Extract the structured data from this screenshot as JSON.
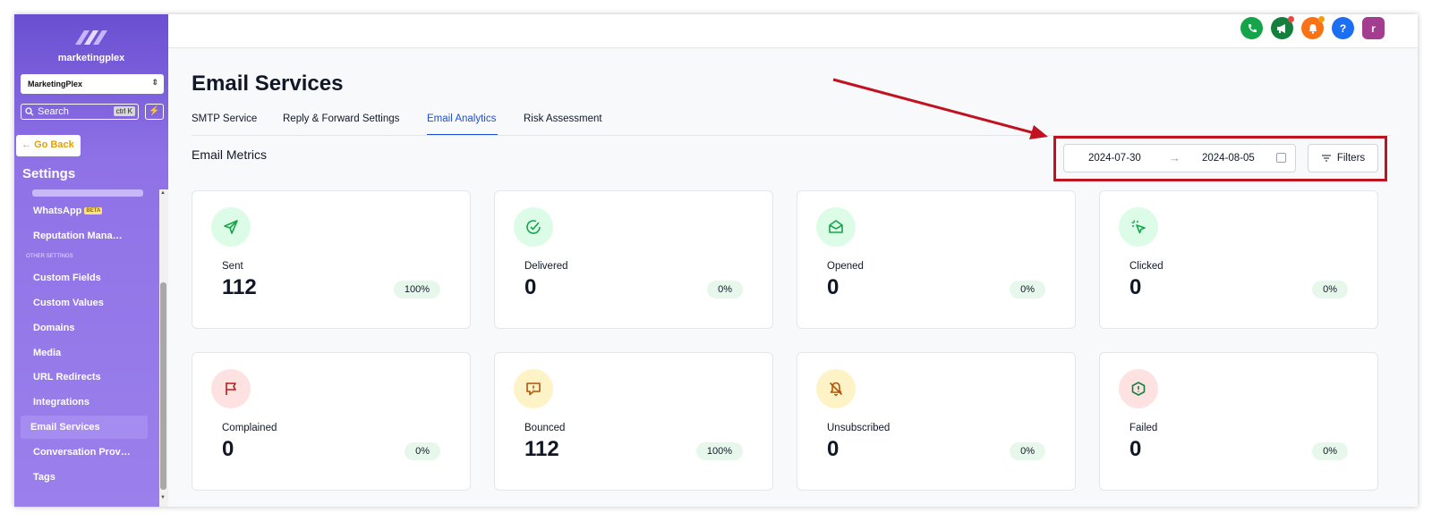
{
  "sidebar": {
    "brand": "marketingplex",
    "account": "MarketingPlex",
    "search_label": "Search",
    "search_shortcut": "ctrl K",
    "go_back": "Go Back",
    "settings_title": "Settings",
    "items": [
      {
        "label": "WhatsApp",
        "badge": "BETA"
      },
      {
        "label": "Reputation Mana…"
      }
    ],
    "section_label": "OTHER SETTINGS",
    "other_items": [
      {
        "label": "Custom Fields"
      },
      {
        "label": "Custom Values"
      },
      {
        "label": "Domains"
      },
      {
        "label": "Media"
      },
      {
        "label": "URL Redirects"
      },
      {
        "label": "Integrations"
      },
      {
        "label": "Email Services"
      },
      {
        "label": "Conversation Prov…"
      },
      {
        "label": "Tags"
      }
    ],
    "active_item": "Email Services"
  },
  "topbar": {
    "avatar_letter": "r",
    "icons": [
      "phone-icon",
      "megaphone-icon",
      "bell-icon",
      "help-icon",
      "avatar"
    ],
    "colors": {
      "phone": "#16a34a",
      "megaphone": "#15803d",
      "bell": "#f97316",
      "help": "#1d6ff2",
      "avatar": "#a23d8f"
    }
  },
  "page": {
    "title": "Email Services",
    "tabs": [
      {
        "label": "SMTP Service"
      },
      {
        "label": "Reply & Forward Settings"
      },
      {
        "label": "Email Analytics",
        "active": true
      },
      {
        "label": "Risk Assessment"
      }
    ],
    "section_title": "Email Metrics",
    "date_range": {
      "start": "2024-07-30",
      "arrow": "→",
      "end": "2024-08-05"
    },
    "filters_label": "Filters"
  },
  "metrics": [
    {
      "label": "Sent",
      "value": "112",
      "percent": "100%",
      "icon": "send-icon",
      "color": "green"
    },
    {
      "label": "Delivered",
      "value": "0",
      "percent": "0%",
      "icon": "check-circle-icon",
      "color": "green"
    },
    {
      "label": "Opened",
      "value": "0",
      "percent": "0%",
      "icon": "mail-open-icon",
      "color": "green"
    },
    {
      "label": "Clicked",
      "value": "0",
      "percent": "0%",
      "icon": "cursor-click-icon",
      "color": "green"
    },
    {
      "label": "Complained",
      "value": "0",
      "percent": "0%",
      "icon": "flag-icon",
      "color": "red"
    },
    {
      "label": "Bounced",
      "value": "112",
      "percent": "100%",
      "icon": "message-alert-icon",
      "color": "amber"
    },
    {
      "label": "Unsubscribed",
      "value": "0",
      "percent": "0%",
      "icon": "bell-off-icon",
      "color": "amber"
    },
    {
      "label": "Failed",
      "value": "0",
      "percent": "0%",
      "icon": "alert-octagon-icon",
      "color": "red"
    }
  ],
  "colors": {
    "accent_tab": "#1d4ed8",
    "highlight_box": "#c1121f",
    "icon_green_bg": "#dcfce7",
    "icon_green_fg": "#16a34a",
    "icon_red_bg": "#fee2e2",
    "icon_red_fg": "#b91c1c",
    "icon_amber_bg": "#fef3c7",
    "icon_amber_fg": "#b45309",
    "pct_badge_bg": "#e7f7ec"
  }
}
